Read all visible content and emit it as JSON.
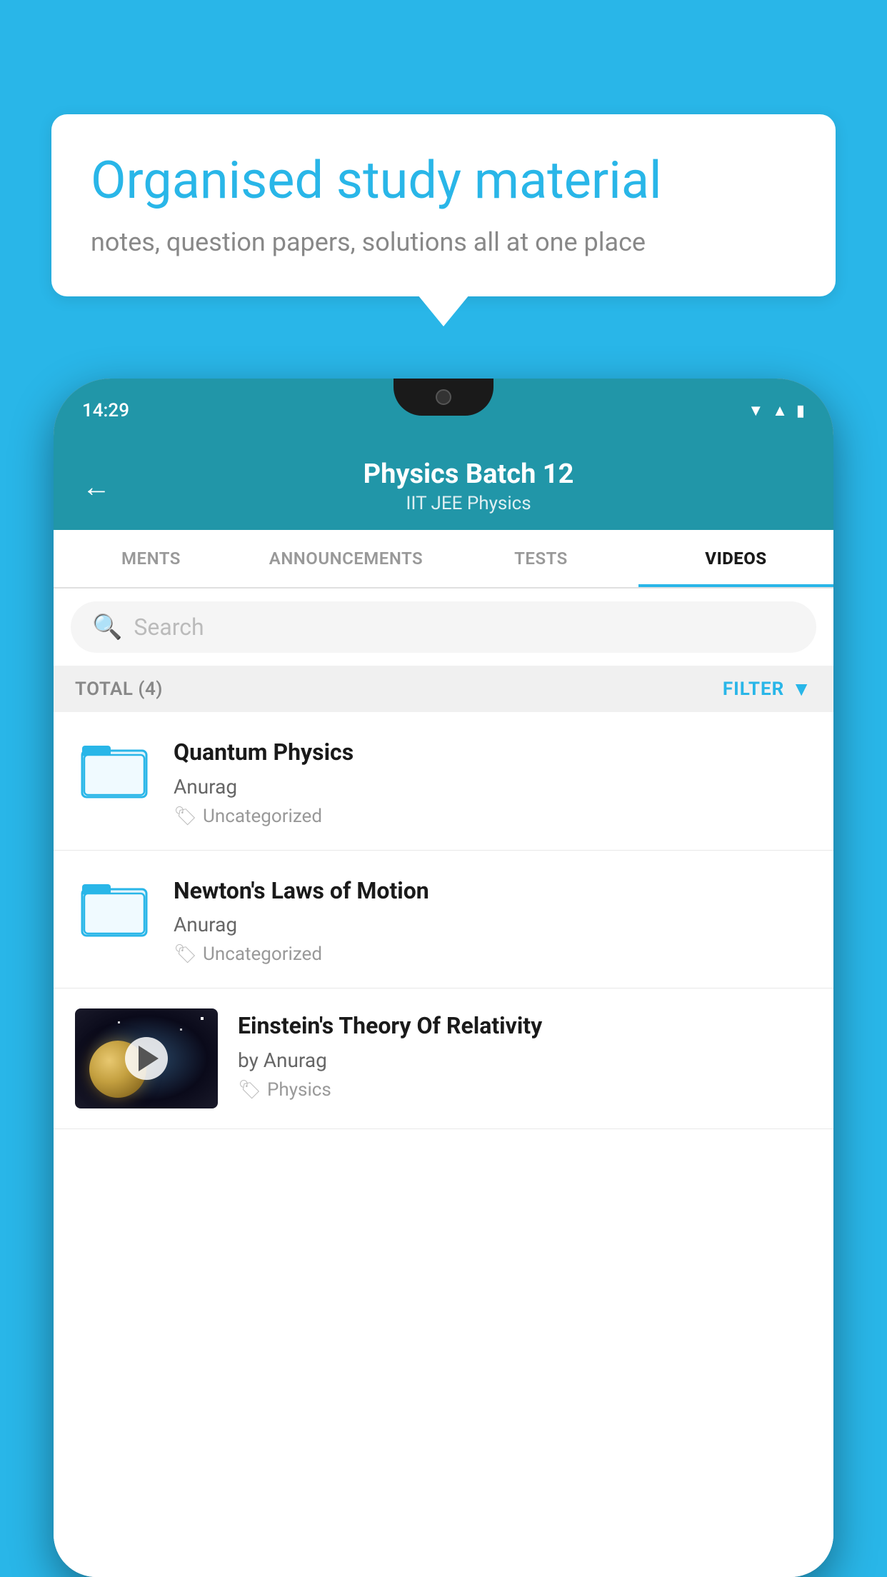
{
  "background_color": "#29b6e8",
  "speech_bubble": {
    "title": "Organised study material",
    "subtitle": "notes, question papers, solutions all at one place"
  },
  "phone": {
    "status_bar": {
      "time": "14:29"
    },
    "app_header": {
      "title": "Physics Batch 12",
      "subtitle_tags": "IIT JEE   Physics",
      "back_label": "←"
    },
    "tabs": [
      {
        "label": "MENTS",
        "active": false
      },
      {
        "label": "ANNOUNCEMENTS",
        "active": false
      },
      {
        "label": "TESTS",
        "active": false
      },
      {
        "label": "VIDEOS",
        "active": true
      }
    ],
    "search": {
      "placeholder": "Search"
    },
    "filter_bar": {
      "total_label": "TOTAL (4)",
      "filter_label": "FILTER"
    },
    "video_items": [
      {
        "id": 1,
        "title": "Quantum Physics",
        "author": "Anurag",
        "tag": "Uncategorized",
        "type": "folder"
      },
      {
        "id": 2,
        "title": "Newton's Laws of Motion",
        "author": "Anurag",
        "tag": "Uncategorized",
        "type": "folder"
      },
      {
        "id": 3,
        "title": "Einstein's Theory Of Relativity",
        "author": "by Anurag",
        "tag": "Physics",
        "type": "video"
      }
    ]
  }
}
